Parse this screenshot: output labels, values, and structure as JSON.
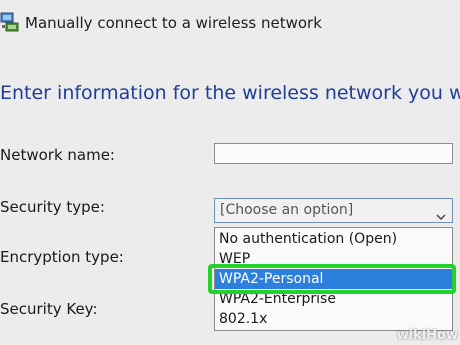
{
  "window": {
    "title": "Manually connect to a wireless network",
    "icon": "network-icon"
  },
  "main": {
    "heading": "Enter information for the wireless network you w",
    "fields": {
      "network_name_label": "Network name:",
      "network_name_value": "",
      "security_type_label": "Security type:",
      "security_type_value": "[Choose an option]",
      "encryption_type_label": "Encryption type:",
      "security_key_label": "Security Key:"
    },
    "dropdown": {
      "options": [
        "No authentication (Open)",
        "WEP",
        "WPA2-Personal",
        "WPA2-Enterprise",
        "802.1x"
      ],
      "highlighted": "WPA2-Personal"
    }
  },
  "watermark": {
    "text": "wikiHow"
  },
  "colors": {
    "heading": "#1f3e99",
    "selection": "#2d7fde",
    "highlight_ring": "#22d12a"
  }
}
